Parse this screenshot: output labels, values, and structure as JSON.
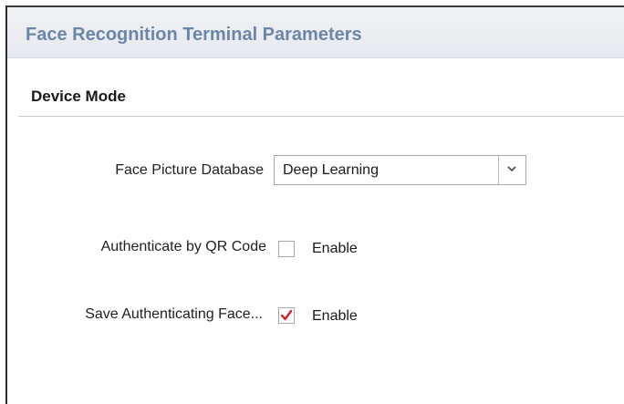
{
  "header": {
    "title": "Face Recognition Terminal Parameters"
  },
  "section": {
    "title": "Device Mode"
  },
  "fields": {
    "face_picture_database": {
      "label": "Face Picture Database",
      "value": "Deep Learning",
      "icon": "chevron-down-icon"
    },
    "authenticate_qr": {
      "label": "Authenticate by QR Code",
      "checkbox_label": "Enable",
      "checked": false
    },
    "save_authenticating_face": {
      "label": "Save Authenticating Face...",
      "checkbox_label": "Enable",
      "checked": true
    }
  },
  "colors": {
    "header_title": "#6b86a8",
    "check_mark": "#d0202a",
    "header_bg": "#eceff3"
  }
}
